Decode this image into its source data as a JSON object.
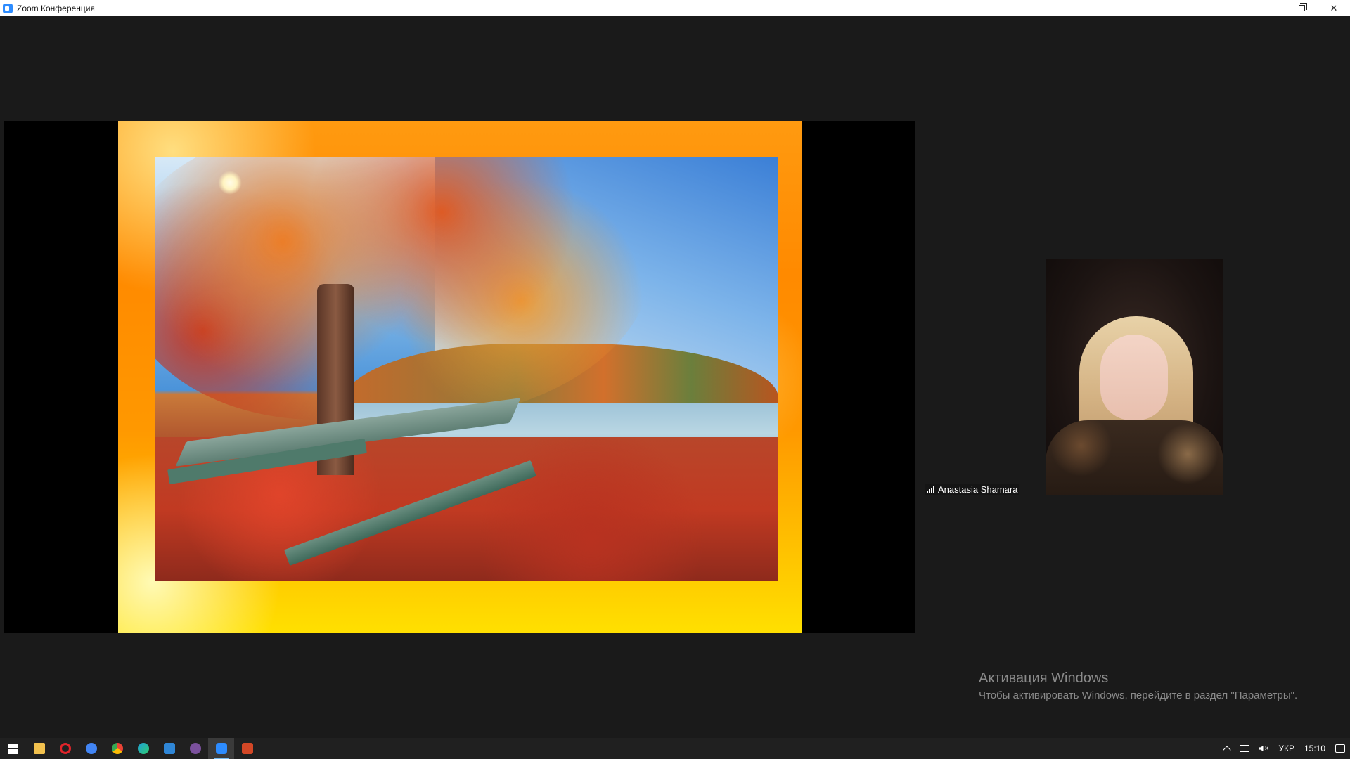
{
  "window": {
    "title": "Zoom Конференция",
    "app_icon": "zoom-icon",
    "controls": [
      "minimize-icon",
      "restore-icon",
      "close-icon"
    ],
    "close_glyph": "✕"
  },
  "share": {
    "content": "autumn-landscape-slide"
  },
  "participant": {
    "name": "Anastasia Shamara",
    "signal_icon": "signal-bars-icon"
  },
  "watermark": {
    "title": "Активация Windows",
    "subtitle": "Чтобы активировать Windows, перейдите в раздел \"Параметры\"."
  },
  "taskbar": {
    "apps": [
      {
        "name": "start",
        "icon": "windows-start-icon",
        "color": "#ffffff"
      },
      {
        "name": "file-explorer",
        "icon": "folder-icon",
        "color": "#f2c14e"
      },
      {
        "name": "opera",
        "icon": "opera-icon",
        "color": "#e0242a"
      },
      {
        "name": "google",
        "icon": "google-icon",
        "color": "#4285f4"
      },
      {
        "name": "chrome",
        "icon": "chrome-icon",
        "color": "#34a853"
      },
      {
        "name": "edge",
        "icon": "edge-icon",
        "color": "#1fa0d8"
      },
      {
        "name": "photos",
        "icon": "photos-icon",
        "color": "#2f86d6"
      },
      {
        "name": "viber",
        "icon": "viber-icon",
        "color": "#7b519d"
      },
      {
        "name": "zoom",
        "icon": "zoom-icon",
        "color": "#2d8cff",
        "active": true
      },
      {
        "name": "powerpoint",
        "icon": "powerpoint-icon",
        "color": "#d24726"
      }
    ],
    "tray": {
      "language": "УКР",
      "time": "15:10"
    }
  }
}
